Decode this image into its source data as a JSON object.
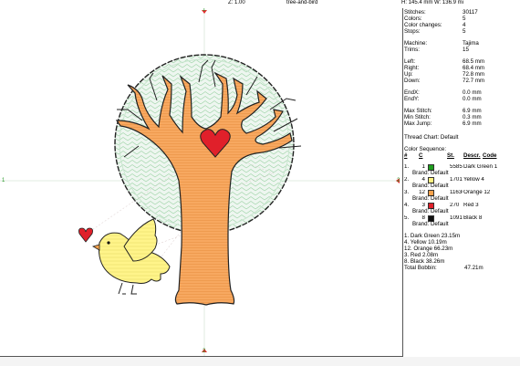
{
  "header": {
    "zoom": "Z: 1.00",
    "design_name": "tree-and-bird",
    "dimensions": "H: 145.4 mm   W: 136.9 mi"
  },
  "axis": {
    "top": "1",
    "left": "1",
    "right": "2",
    "bottom": "2"
  },
  "stats": [
    {
      "label": "Stitches:",
      "value": "30117"
    },
    {
      "label": "Colors:",
      "value": "5"
    },
    {
      "label": "Color changes:",
      "value": "4"
    },
    {
      "label": "Stops:",
      "value": "5"
    },
    {
      "label": "Machine:",
      "value": "Tajima"
    },
    {
      "label": "Trims:",
      "value": "15"
    },
    {
      "label": "Left:",
      "value": "68.5 mm"
    },
    {
      "label": "Right:",
      "value": "68.4 mm"
    },
    {
      "label": "Up:",
      "value": "72.8 mm"
    },
    {
      "label": "Down:",
      "value": "72.7 mm"
    },
    {
      "label": "EndX:",
      "value": "0.0 mm"
    },
    {
      "label": "EndY:",
      "value": "0.0 mm"
    },
    {
      "label": "Max Stitch:",
      "value": "6.9 mm"
    },
    {
      "label": "Min Stitch:",
      "value": "0.3 mm"
    },
    {
      "label": "Max Jump:",
      "value": "6.9 mm"
    }
  ],
  "thread_chart": "Thread Chart: Default",
  "sequence": {
    "title": "Color Sequence:",
    "headers": {
      "num": "#",
      "c": "C",
      "st": "St.",
      "desc": "Descr.",
      "code": "Code"
    },
    "rows": [
      {
        "idx": "1.",
        "code": "1",
        "color": "#1e9e1e",
        "stitches": "5585",
        "desc": "Dark Green 1",
        "brand": "Brand: Default"
      },
      {
        "idx": "2.",
        "code": "4",
        "color": "#fff080",
        "stitches": "1701",
        "desc": "Yellow 4",
        "brand": "Brand: Default"
      },
      {
        "idx": "3.",
        "code": "12",
        "color": "#f7a24c",
        "stitches": "11636",
        "desc": "Orange 12",
        "brand": "Brand: Default"
      },
      {
        "idx": "4.",
        "code": "3",
        "color": "#e0202a",
        "stitches": "270",
        "desc": "Red 3",
        "brand": "Brand: Default"
      },
      {
        "idx": "5.",
        "code": "8",
        "color": "#111111",
        "stitches": "10915",
        "desc": "Black 8",
        "brand": "Brand: Default"
      }
    ]
  },
  "lengths": [
    "1. Dark Green 23.15m",
    "4. Yellow 10.19m",
    "12. Orange 66.23m",
    "3. Red 2.08m",
    "8. Black 38.26m"
  ],
  "total_bobbin": {
    "label": "Total Bobbin:",
    "value": "47.21m"
  },
  "colors": {
    "green": "#1e9e1e",
    "green_fill": "#e8f3ec",
    "yellow": "#fff080",
    "orange": "#f7a24c",
    "red": "#e0202a",
    "black": "#111111",
    "axis_red": "#e03030",
    "axis_green": "#2a9a2a"
  }
}
